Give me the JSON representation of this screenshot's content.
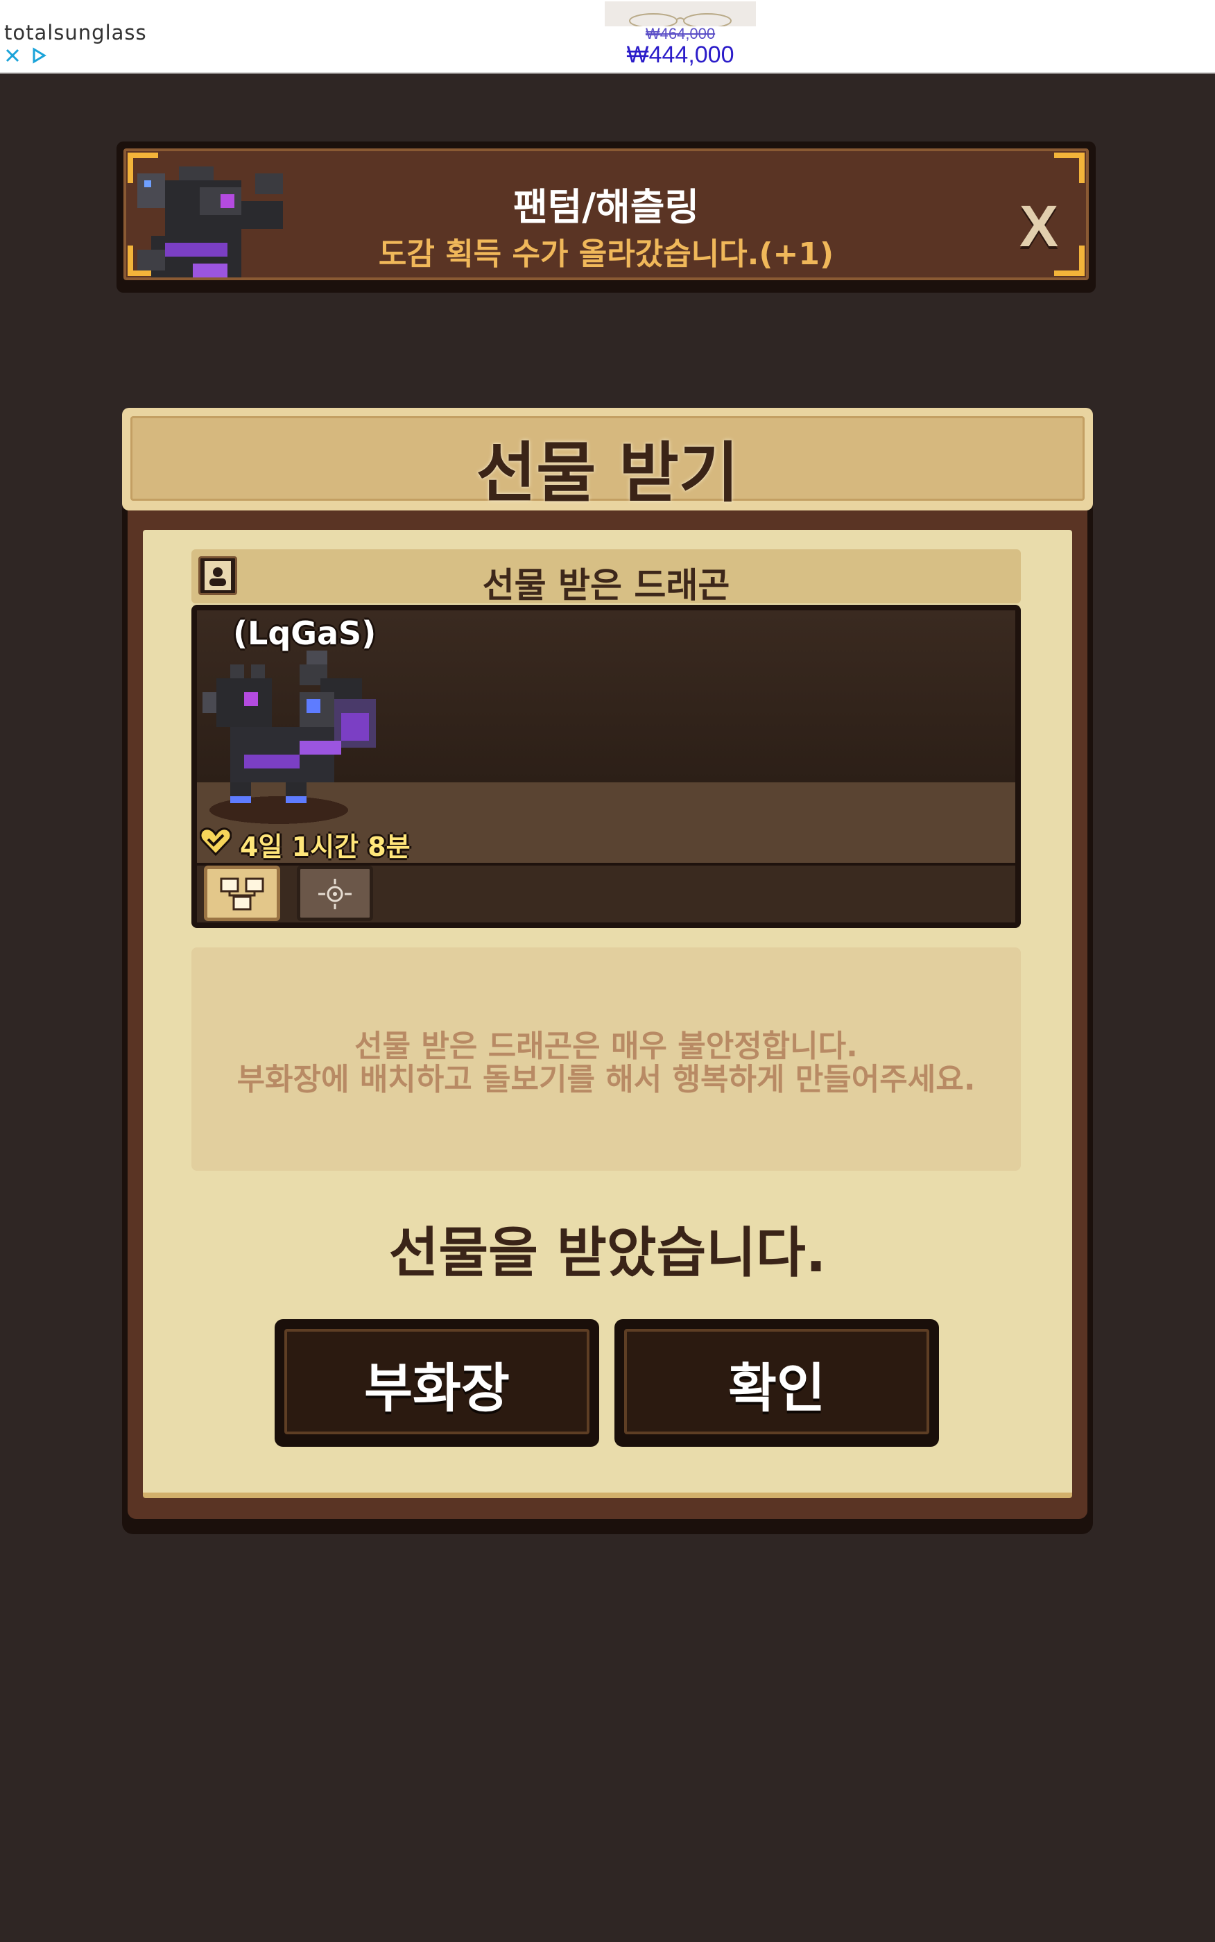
{
  "ad": {
    "brand": "totalsunglass",
    "old_price": "₩464,000",
    "new_price": "₩444,000"
  },
  "notice": {
    "title": "팬텀/해츨링",
    "subtitle": "도감 획득 수가 올라갔습니다.(+1)",
    "close_label": "X"
  },
  "dialog": {
    "title": "선물 받기",
    "section_title": "선물 받은 드래곤",
    "dragon_name": "(LqGaS)",
    "timer": "4일 1시간 8분",
    "message_line1": "선물 받은 드래곤은 매우 불안정합니다.",
    "message_line2": "부화장에 배치하고 돌보기를 해서 행복하게 만들어주세요.",
    "result": "선물을 받았습니다.",
    "hatchery_button": "부화장",
    "confirm_button": "확인"
  },
  "colors": {
    "background": "#2f2624",
    "parchment": "#e9dcab",
    "accent_gold": "#f3b43a",
    "dragon_purple": "#7b3fc4"
  }
}
